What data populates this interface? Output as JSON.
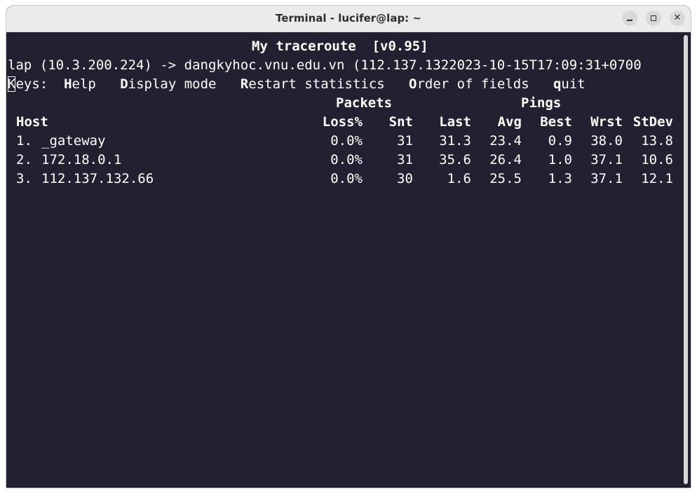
{
  "window": {
    "title": "Terminal - lucifer@lap: ~",
    "buttons": {
      "minimize": "–",
      "maximize": "□",
      "close": "✕"
    }
  },
  "terminal": {
    "header": "My traceroute  [v0.95]",
    "route_line": "lap (10.3.200.224) -> dangkyhoc.vnu.edu.vn (112.137.1322023-10-15T17:09:31+0700",
    "keys": {
      "label_cursor": "K",
      "label_rest": "eys:  ",
      "help_key": "H",
      "help_rest": "elp   ",
      "display_key": "D",
      "display_rest": "isplay mode   ",
      "restart_key": "R",
      "restart_rest": "estart statistics   ",
      "order_key": "O",
      "order_rest": "rder of fields   ",
      "quit_key": "q",
      "quit_rest": "uit"
    },
    "group_headers": {
      "packets": "Packets",
      "pings": "Pings"
    },
    "columns": {
      "host": "Host",
      "loss": "Loss%",
      "snt": "Snt",
      "last": "Last",
      "avg": "Avg",
      "best": "Best",
      "wrst": "Wrst",
      "stdev": "StDev"
    },
    "hops": [
      {
        "num": "1.",
        "host": "_gateway",
        "loss": "0.0%",
        "snt": "31",
        "last": "31.3",
        "avg": "23.4",
        "best": "0.9",
        "wrst": "38.0",
        "stdev": "13.8"
      },
      {
        "num": "2.",
        "host": "172.18.0.1",
        "loss": "0.0%",
        "snt": "31",
        "last": "35.6",
        "avg": "26.4",
        "best": "1.0",
        "wrst": "37.1",
        "stdev": "10.6"
      },
      {
        "num": "3.",
        "host": "112.137.132.66",
        "loss": "0.0%",
        "snt": "30",
        "last": "1.6",
        "avg": "25.5",
        "best": "1.3",
        "wrst": "37.1",
        "stdev": "12.1"
      }
    ]
  },
  "colors": {
    "terminal_bg": "#232031",
    "terminal_fg": "#ffffff",
    "titlebar_bg": "#ebebeb"
  }
}
